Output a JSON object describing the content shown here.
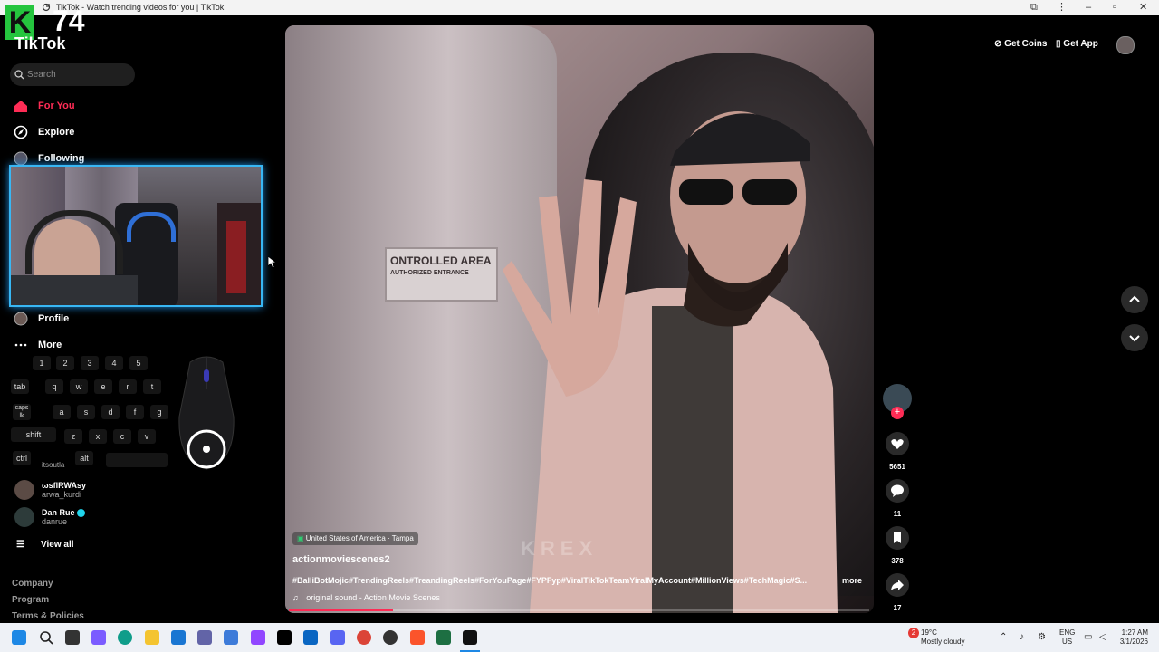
{
  "browser": {
    "tab_title": "TikTok - Watch trending videos for you | TikTok"
  },
  "overlay": {
    "logo_letter": "K",
    "logo_number": "74"
  },
  "sidebar": {
    "logo": "TikTok",
    "search_placeholder": "Search",
    "nav": [
      {
        "label": "For You",
        "icon": "home-icon"
      },
      {
        "label": "Explore",
        "icon": "compass-icon"
      },
      {
        "label": "Following",
        "icon": "following-icon"
      },
      {
        "label": "Profile",
        "icon": "profile-icon"
      },
      {
        "label": "More",
        "icon": "more-icon"
      }
    ],
    "accounts": [
      {
        "name": "ωsflRWAsy",
        "username": "arwa_kurdi"
      },
      {
        "name": "Dan Rue",
        "username": "danrue",
        "verified": true
      }
    ],
    "view_all": "View all",
    "footer": [
      "Company",
      "Program",
      "Terms & Policies"
    ]
  },
  "keyboard_overlay": {
    "row1": [
      "1",
      "2",
      "3",
      "4",
      "5"
    ],
    "row2": [
      "tab",
      "q",
      "w",
      "e",
      "r",
      "t"
    ],
    "row3": [
      "caps lk",
      "a",
      "s",
      "d",
      "f",
      "g"
    ],
    "row4": [
      "shift",
      "z",
      "x",
      "c",
      "v"
    ],
    "row5": [
      "ctrl",
      "alt"
    ],
    "partial_text": "itsoutla"
  },
  "video": {
    "location": "United States of America · Tampa",
    "author": "actionmoviescenes2",
    "hashtags": "#BalliBotMojic#TrendingReels#TreandingReels#ForYouPage#FYPFyp#ViralTikTokTeamYiralMyAccount#MillionViews#TechMagic#S...",
    "more": "more",
    "sound": "original sound - Action Movie Scenes",
    "sign_text": "ONTROLLED AREA",
    "sign_subtext": "AUTHORIZED ENTRANCE",
    "watermark": "KREX",
    "progress": 0.18
  },
  "actions": {
    "likes": "5651",
    "comments": "11",
    "saves": "378",
    "shares": "17"
  },
  "topbar": {
    "get_coins": "Get Coins",
    "get_app": "Get App"
  },
  "taskbar": {
    "weather_temp": "19°C",
    "weather_desc": "Mostly cloudy",
    "weather_badge": "2",
    "lang": "ENG",
    "region": "US",
    "time": "1:27 AM",
    "date": "3/1/2026"
  },
  "colors": {
    "accent": "#fe2c55",
    "webcam_border": "#38b7f4"
  }
}
